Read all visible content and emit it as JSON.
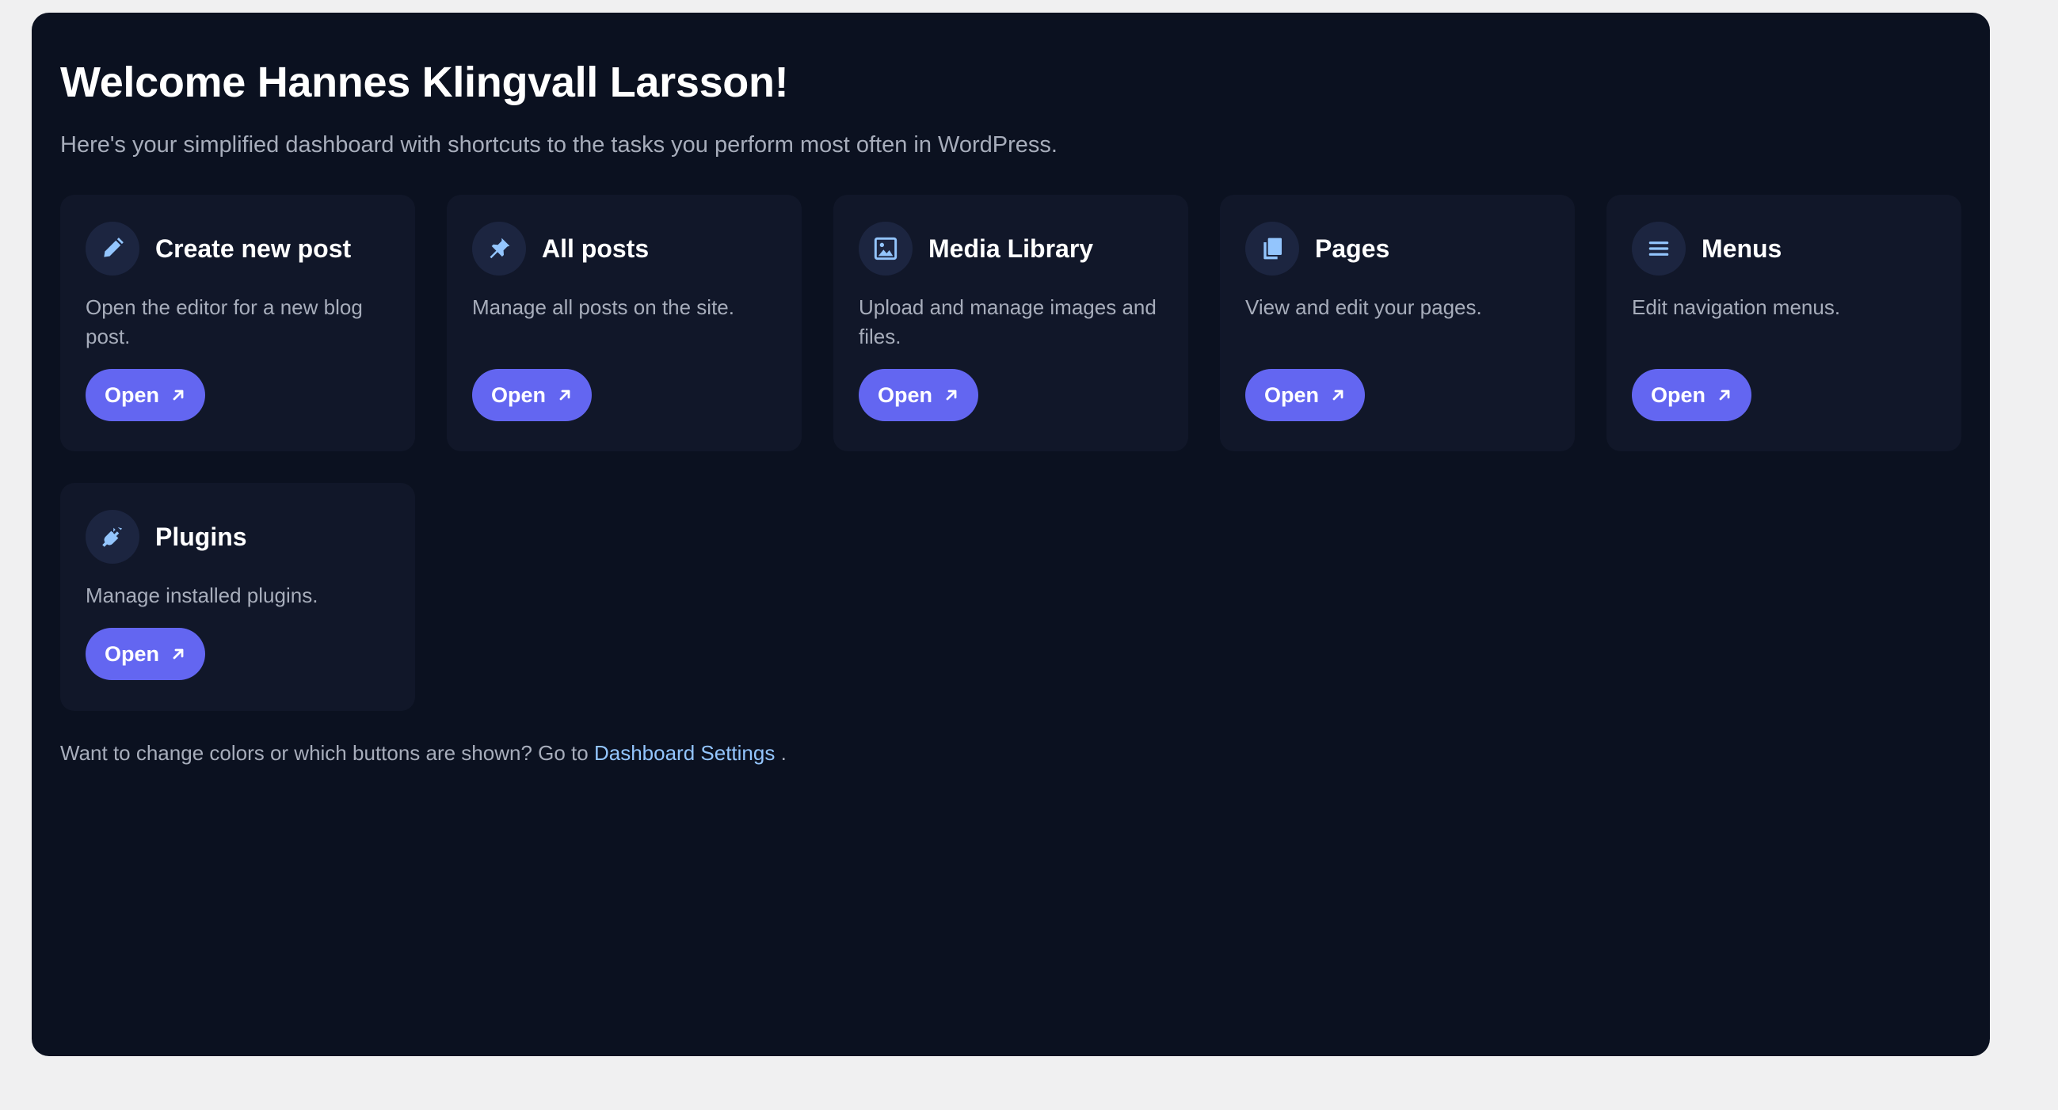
{
  "header": {
    "title": "Welcome Hannes Klingvall Larsson!",
    "subtitle": "Here's your simplified dashboard with shortcuts to the tasks you perform most often in WordPress."
  },
  "cards": [
    {
      "title": "Create new post",
      "description": "Open the editor for a new blog post.",
      "icon": "pencil-icon",
      "button": "Open"
    },
    {
      "title": "All posts",
      "description": "Manage all posts on the site.",
      "icon": "pin-icon",
      "button": "Open"
    },
    {
      "title": "Media Library",
      "description": "Upload and manage images and files.",
      "icon": "image-icon",
      "button": "Open"
    },
    {
      "title": "Pages",
      "description": "View and edit your pages.",
      "icon": "pages-icon",
      "button": "Open"
    },
    {
      "title": "Menus",
      "description": "Edit navigation menus.",
      "icon": "menu-icon",
      "button": "Open"
    },
    {
      "title": "Plugins",
      "description": "Manage installed plugins.",
      "icon": "plug-icon",
      "button": "Open"
    }
  ],
  "footer": {
    "text": "Want to change colors or which buttons are shown? Go to",
    "link": "Dashboard Settings",
    "suffix": "."
  },
  "colors": {
    "page_background": "#f0f0f1",
    "panel_background": "#0b1120",
    "card_background": "#111729",
    "accent": "#6366f1",
    "icon_color": "#93c5fd",
    "link_color": "#93c5fd"
  }
}
